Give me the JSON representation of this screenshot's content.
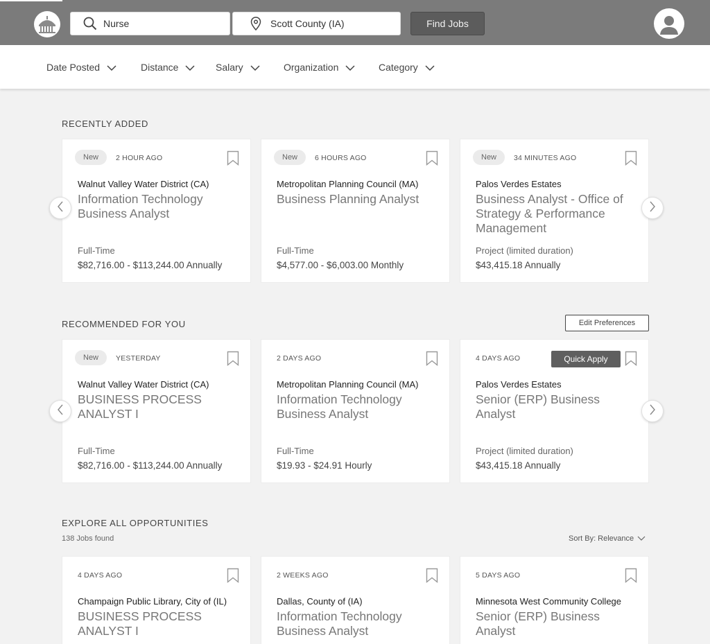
{
  "search": {
    "keyword_value": "Nurse",
    "location_value": "Scott County (IA)",
    "find_label": "Find Jobs"
  },
  "filters": [
    {
      "label": "Date Posted"
    },
    {
      "label": "Distance"
    },
    {
      "label": "Salary"
    },
    {
      "label": "Organization"
    },
    {
      "label": "Category"
    }
  ],
  "recently_added": {
    "title": "RECENTLY ADDED",
    "cards": [
      {
        "badge": "New",
        "time": "2 HOUR AGO",
        "org": "Walnut Valley Water District (CA)",
        "title": "Information Technology Business Analyst",
        "type": "Full-Time",
        "salary": "$82,716.00 - $113,244.00 Annually"
      },
      {
        "badge": "New",
        "time": "6 HOURS AGO",
        "org": "Metropolitan Planning Council (MA)",
        "title": "Business Planning Analyst",
        "type": "Full-Time",
        "salary": "$4,577.00 - $6,003.00 Monthly"
      },
      {
        "badge": "New",
        "time": "34 MINUTES AGO",
        "org": "Palos Verdes Estates",
        "title": "Business Analyst - Office of Strategy & Performance Management",
        "type": "Project (limited duration)",
        "salary": "$43,415.18 Annually"
      }
    ]
  },
  "recommended": {
    "title": "RECOMMENDED FOR YOU",
    "edit_label": "Edit Preferences",
    "quick_apply_label": "Quick Apply",
    "cards": [
      {
        "badge": "New",
        "time": "YESTERDAY",
        "org": "Walnut Valley Water District (CA)",
        "title": "BUSINESS PROCESS ANALYST I",
        "type": "Full-Time",
        "salary": "$82,716.00 - $113,244.00 Annually"
      },
      {
        "badge": "",
        "time": "2 DAYS AGO",
        "org": "Metropolitan Planning Council (MA)",
        "title": "Information Technology Business Analyst",
        "type": "Full-Time",
        "salary": "$19.93 - $24.91 Hourly"
      },
      {
        "badge": "",
        "time": "4 DAYS AGO",
        "org": "Palos Verdes Estates",
        "title": "Senior (ERP) Business Analyst",
        "type": "Project (limited duration)",
        "salary": "$43,415.18 Annually"
      }
    ]
  },
  "explore": {
    "title": "EXPLORE ALL OPPORTUNITIES",
    "jobs_count": "138",
    "jobs_suffix": "Jobs found",
    "sort_label": "Sort By: Relevance",
    "cards": [
      {
        "time": "4 DAYS AGO",
        "org": "Champaign Public Library, City of (IL)",
        "title": "BUSINESS PROCESS ANALYST I"
      },
      {
        "time": "2 WEEKS AGO",
        "org": "Dallas, County of (IA)",
        "title": "Information Technology Business Analyst"
      },
      {
        "time": "5 DAYS AGO",
        "org": "Minnesota West Community College",
        "title": "Senior (ERP) Business Analyst"
      }
    ]
  },
  "colors": {
    "topbar": "#7b7b7b",
    "button_dark": "#5c5c5c",
    "page_bg": "#f2f2f2"
  }
}
